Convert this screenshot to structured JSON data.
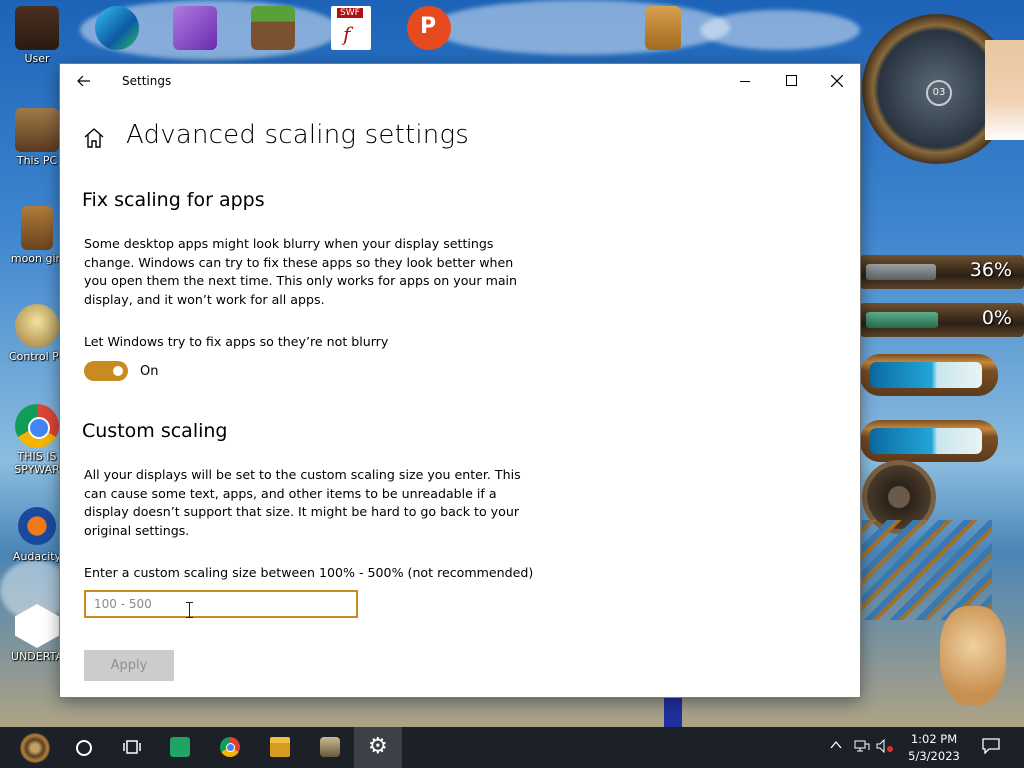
{
  "desktop": {
    "icons": [
      {
        "label": "User"
      },
      {
        "label": "This PC"
      },
      {
        "label": "moon girl"
      },
      {
        "label": "Control Pa"
      },
      {
        "label": "THIS IS"
      },
      {
        "label": "SPYWAR"
      },
      {
        "label": "Audacity"
      },
      {
        "label": "UNDERTA"
      }
    ],
    "top_icons": [
      {
        "label": "Edge"
      },
      {
        "label": "VS"
      },
      {
        "label": "Minecraft"
      },
      {
        "label": "SWF"
      },
      {
        "label": "P"
      },
      {
        "label": "Notepad"
      }
    ],
    "swf_badge": "SWF",
    "clock_widget_number": "03",
    "gauges": [
      {
        "text": "36%",
        "level": 0.36
      },
      {
        "text": "0%",
        "level": 0.0
      }
    ]
  },
  "window": {
    "title": "Settings",
    "page_title": "Advanced scaling settings",
    "fix_section": {
      "heading": "Fix scaling for apps",
      "description": "Some desktop apps might look blurry when your display settings change. Windows can try to fix these apps so they look better when you open them the next time. This only works for apps on your main display, and it won’t work for all apps.",
      "toggle_label": "Let Windows try to fix apps so they’re not blurry",
      "toggle_state": "On",
      "toggle_on": true
    },
    "custom_section": {
      "heading": "Custom scaling",
      "description": "All your displays will be set to the custom scaling size you enter. This can cause some text, apps, and other items to be unreadable if a display doesn’t support that size. It might be hard to go back to your original settings.",
      "input_label": "Enter a custom scaling size between 100% - 500% (not recommended)",
      "input_value": "",
      "input_placeholder": "100 - 500",
      "apply_label": "Apply"
    }
  },
  "taskbar": {
    "apps": [
      "start",
      "search",
      "task-view",
      "spreadsheet",
      "chrome",
      "file-explorer",
      "app",
      "settings"
    ],
    "active_app": "settings",
    "clock_time": "1:02 PM",
    "clock_date": "5/3/2023"
  },
  "colors": {
    "accent": "#c98a1f",
    "taskbar": "#1c2027"
  }
}
